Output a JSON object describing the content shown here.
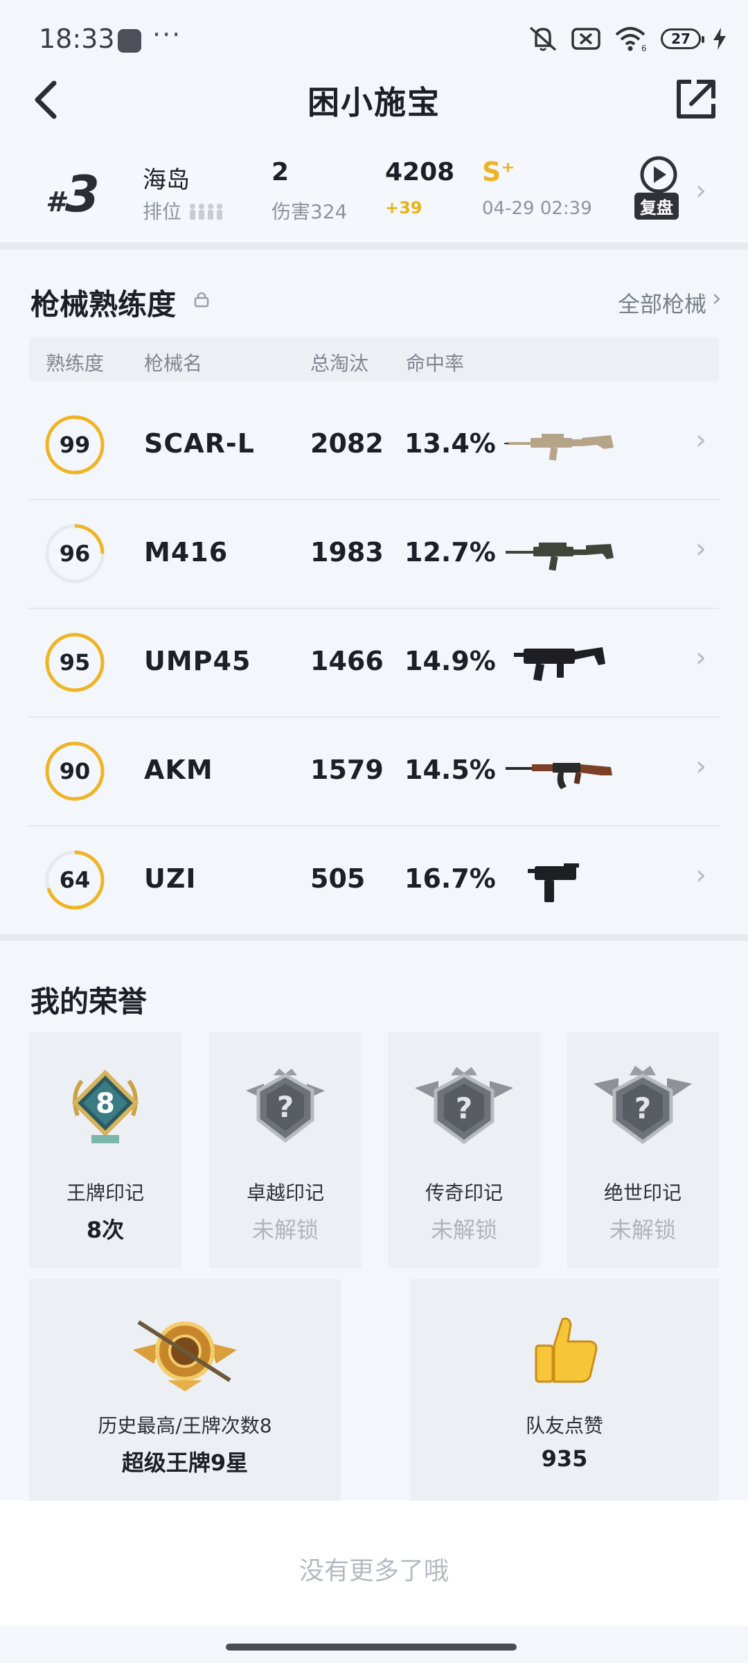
{
  "status": {
    "time": "18:33",
    "dots": "···",
    "battery": "27"
  },
  "header": {
    "title": "困小施宝"
  },
  "match": {
    "rank_hash": "#",
    "rank": "3",
    "map": "海岛",
    "map_sub": "排位",
    "kills": "2",
    "damage": "伤害324",
    "score": "4208",
    "score_delta": "+39",
    "tier": "S⁺",
    "date": "04-29 02:39",
    "replay_label": "复盘"
  },
  "weapons": {
    "title": "枪械熟练度",
    "all_label": "全部枪械",
    "headers": [
      "熟练度",
      "枪械名",
      "总淘汰",
      "命中率"
    ],
    "rows": [
      {
        "level": "99",
        "name": "SCAR-L",
        "kills": "2082",
        "rate": "13.4%",
        "ring": 1.0,
        "icon": "rifle-tan-icon"
      },
      {
        "level": "96",
        "name": "M416",
        "kills": "1983",
        "rate": "12.7%",
        "ring": 0.25,
        "icon": "rifle-green-icon"
      },
      {
        "level": "95",
        "name": "UMP45",
        "kills": "1466",
        "rate": "14.9%",
        "ring": 1.0,
        "icon": "smg-black-icon"
      },
      {
        "level": "90",
        "name": "AKM",
        "kills": "1579",
        "rate": "14.5%",
        "ring": 1.0,
        "icon": "rifle-wood-icon"
      },
      {
        "level": "64",
        "name": "UZI",
        "kills": "505",
        "rate": "16.7%",
        "ring": 0.7,
        "icon": "uzi-icon"
      }
    ]
  },
  "honors": {
    "title": "我的荣誉",
    "cards": [
      {
        "label": "王牌印记",
        "value": "8次",
        "badge_num": "8",
        "locked": false
      },
      {
        "label": "卓越印记",
        "value": "未解锁",
        "locked": true
      },
      {
        "label": "传奇印记",
        "value": "未解锁",
        "locked": true
      },
      {
        "label": "绝世印记",
        "value": "未解锁",
        "locked": true
      }
    ],
    "history": {
      "label": "历史最高/王牌次数8",
      "value": "超级王牌9星"
    },
    "likes": {
      "label": "队友点赞",
      "value": "935"
    }
  },
  "footer": {
    "no_more": "没有更多了哦"
  },
  "colors": {
    "accent": "#f0b323",
    "ring_track": "#e6e9ee"
  }
}
